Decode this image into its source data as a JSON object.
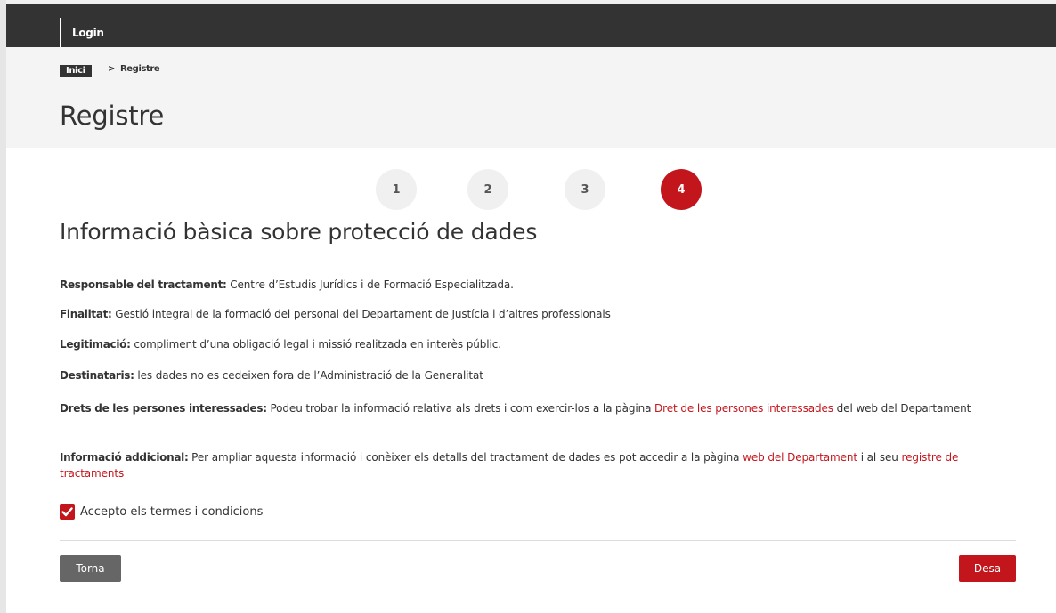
{
  "nav": {
    "login_label": "Login"
  },
  "breadcrumb": {
    "home": "Inici",
    "separator": ">",
    "current": "Registre"
  },
  "page": {
    "title": "Registre"
  },
  "steps": [
    {
      "label": "1",
      "active": false
    },
    {
      "label": "2",
      "active": false
    },
    {
      "label": "3",
      "active": false
    },
    {
      "label": "4",
      "active": true
    }
  ],
  "section": {
    "title": "Informació bàsica sobre protecció de dades",
    "items": [
      {
        "label": "Responsable del tractament:",
        "text": " Centre d’Estudis Jurídics i de Formació Especialitzada."
      },
      {
        "label": "Finalitat:",
        "text": " Gestió integral de la formació del personal del Departament de Justícia i d’altres professionals"
      },
      {
        "label": "Legitimació:",
        "text": " compliment d’una obligació legal i missió realitzada en interès públic."
      },
      {
        "label": "Destinataris:",
        "text": " les dades no es cedeixen fora de l’Administració de la Generalitat"
      },
      {
        "label": "Drets de les persones interessades:",
        "text_before": " Podeu trobar la informació relativa als drets i com exercir-los a la pàgina ",
        "link": "Dret de les persones interessades",
        "text_after": " del web del Departament"
      },
      {
        "label": "Informació addicional:",
        "text_before": " Per ampliar aquesta informació i conèixer els detalls del tractament de dades es pot accedir a la pàgina ",
        "link": "web del Departament",
        "text_middle": " i al seu ",
        "link2": "registre de tractaments"
      }
    ]
  },
  "terms": {
    "label": "Accepto els termes i condicions",
    "checked": true
  },
  "buttons": {
    "back": "Torna",
    "save": "Desa"
  },
  "colors": {
    "accent": "#c3161c",
    "topbar": "#333333",
    "header_band": "#f3f4f3",
    "back_button": "#666666"
  }
}
